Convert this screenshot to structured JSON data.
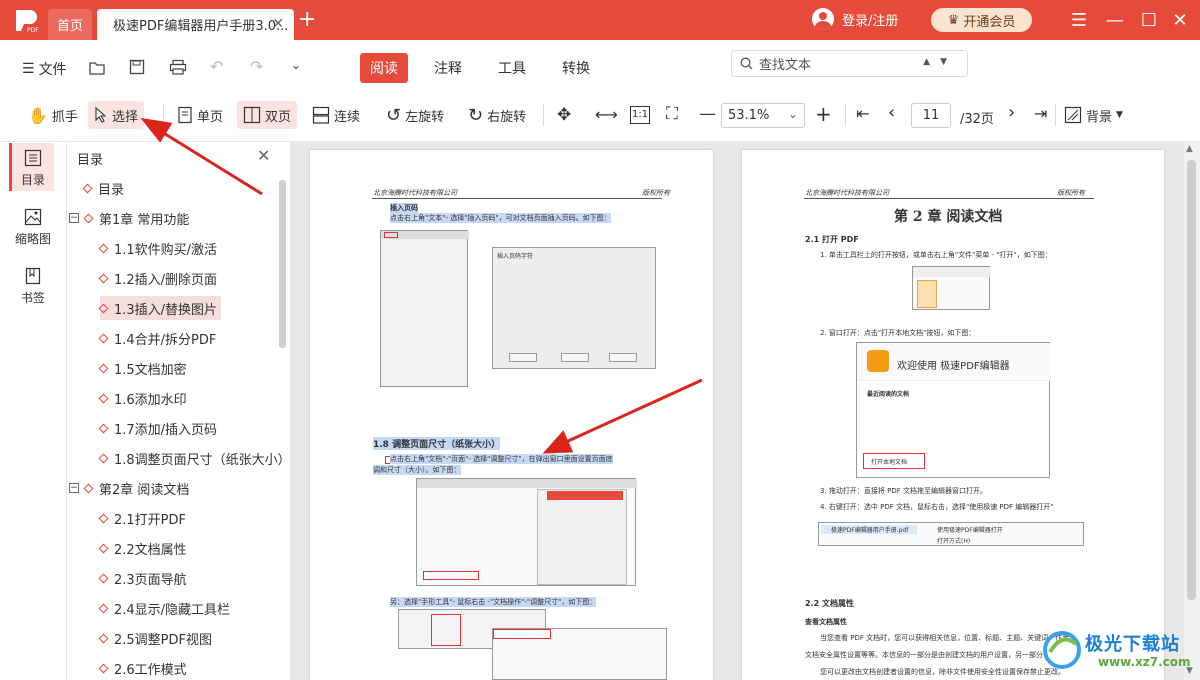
{
  "titlebar": {
    "home_tab": "首页",
    "doc_tab": "极速PDF编辑器用户手册3.0...",
    "login": "登录/注册",
    "vip": "开通会员"
  },
  "toolbar1": {
    "file": "文件",
    "tabs": [
      "阅读",
      "注释",
      "工具",
      "转换"
    ],
    "search_placeholder": "查找文本"
  },
  "toolbar2": {
    "hand": "抓手",
    "select": "选择",
    "single": "单页",
    "double": "双页",
    "continuous": "连续",
    "rotate_left": "左旋转",
    "rotate_right": "右旋转",
    "zoom": "53.1%",
    "page": "11",
    "total": "/32页",
    "background": "背景"
  },
  "leftrail": {
    "toc": "目录",
    "thumb": "缩略图",
    "bookmark": "书签"
  },
  "outline": {
    "title": "目录",
    "items": [
      {
        "label": "目录"
      },
      {
        "label": "第1章 常用功能"
      },
      {
        "label": "1.1软件购买/激活"
      },
      {
        "label": "1.2插入/删除页面"
      },
      {
        "label": "1.3插入/替换图片"
      },
      {
        "label": "1.4合并/拆分PDF"
      },
      {
        "label": "1.5文档加密"
      },
      {
        "label": "1.6添加水印"
      },
      {
        "label": "1.7添加/插入页码"
      },
      {
        "label": "1.8调整页面尺寸（纸张大小）"
      },
      {
        "label": "第2章 阅读文档"
      },
      {
        "label": "2.1打开PDF"
      },
      {
        "label": "2.2文档属性"
      },
      {
        "label": "2.3页面导航"
      },
      {
        "label": "2.4显示/隐藏工具栏"
      },
      {
        "label": "2.5调整PDF视图"
      },
      {
        "label": "2.6工作模式"
      }
    ]
  },
  "left_page": {
    "header_left": "北京海腾时代科技有限公司",
    "header_right": "版权所有",
    "insert_title": "插入页码",
    "insert_desc": "点击右上角\"文本\"- 选择\"插入页码\"，可对文档页面插入页码。如下图：",
    "dialog_title": "插入页码字符",
    "sec18": "1.8 调整页面尺寸（纸张大小）",
    "sec18_desc1": "点击右上角\"文档\"-\"页面\"- 选择\"调整尺寸\"，在弹出窗口里面设置页面底",
    "sec18_desc2": "调和尺寸（大小）。如下图：",
    "alt": "另：选择\"手形工具\"- 鼠标右击 -\"文档操作\"-\"调整尺寸\"，如下图："
  },
  "right_page": {
    "header_left": "北京海腾时代科技有限公司",
    "header_right": "版权所有",
    "chapter": "第 2 章  阅读文档",
    "s21": "2.1 打开 PDF",
    "s21_1": "1. 单击工具栏上的打开按钮，或单击右上角\"文件\"菜单 - \"打开\"，如下图：",
    "s21_2": "2. 窗口打开：点击\"打开本地文档\"按钮，如下图：",
    "welcome": "欢迎使用 极速PDF编辑器",
    "recent": "最近阅读的文档",
    "open_local": "打开本地文档",
    "s21_3": "3. 拖动打开：直接将 PDF 文档拖至编辑器窗口打开。",
    "s21_4": "4. 右键打开：选中 PDF 文档，鼠标右击，选择\"使用极速 PDF 编辑器打开\"",
    "ctx_file": "极速PDF编辑器用户手册.pdf",
    "ctx_open": "使用极速PDF编辑器打开",
    "ctx_openwith": "打开方式(H)",
    "s22": "2.2 文档属性",
    "s22_sub": "查看文档属性",
    "s22_p1": "当您查看 PDF 文档时，您可以获得相关信息，位置、标题、主题、关键词、作者",
    "s22_p2": "文档安全属性设置等等。本信息的一部分是由创建文档的用户设置，另一部分",
    "s22_p3": "您可以更改由文档创建者设置的信息，除非文件使用安全性设置保存禁止更改。"
  },
  "watermark": {
    "brand": "极光下载站",
    "url": "www.xz7.com"
  },
  "colors": {
    "accent": "#e64a3b",
    "highlight": "#fbe3e0"
  }
}
